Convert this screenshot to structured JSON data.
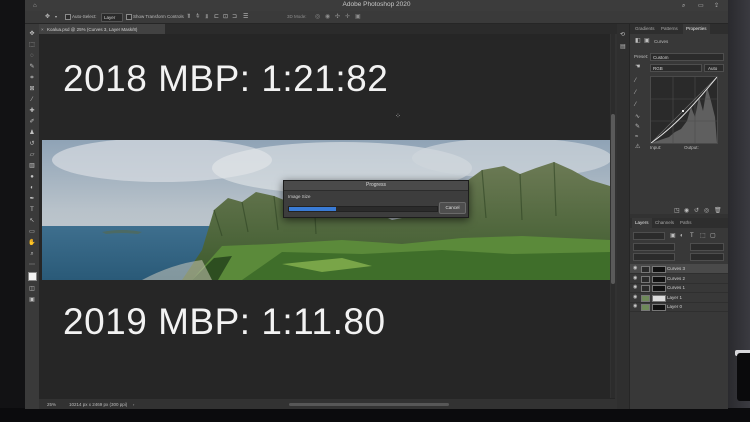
{
  "app": {
    "title": "Adobe Photoshop 2020"
  },
  "options_bar": {
    "auto_select_label": "Auto-Select:",
    "auto_select_value": "Layer",
    "show_transform_label": "Show Transform Controls",
    "mode_label": "3D Mode:"
  },
  "document": {
    "tab_title": "Koalua.psd @ 25% (Curves 3, Layer Mask/8)",
    "zoom": "25%",
    "doc_info": "10214 px x 2469 px (300 ppi)"
  },
  "canvas": {
    "top_text": "2018 MBP: 1:21:82",
    "bottom_text": "2019 MBP: 1:11.80"
  },
  "progress_dialog": {
    "title": "Progress",
    "task": "Image Size",
    "progress_fraction": 0.32,
    "cancel_label": "Cancel",
    "accent": "#3a7bd5"
  },
  "panels": {
    "top_tabs": [
      "Gradients",
      "Patterns",
      "Properties"
    ],
    "active_top_tab": "Properties",
    "properties": {
      "type": "Curves",
      "preset_label": "Preset:",
      "preset_value": "Custom",
      "channel_value": "RGB",
      "auto_label": "Auto",
      "input_label": "Input:",
      "output_label": "Output:"
    },
    "layer_tabs": [
      "Layers",
      "Channels",
      "Paths"
    ],
    "active_layer_tab": "Layers",
    "layers": [
      {
        "name": "Curves 3",
        "selected": true
      },
      {
        "name": "Curves 2",
        "selected": false
      },
      {
        "name": "Curves 1",
        "selected": false
      },
      {
        "name": "Layer 1",
        "selected": false
      },
      {
        "name": "Layer 0",
        "selected": false
      }
    ]
  }
}
